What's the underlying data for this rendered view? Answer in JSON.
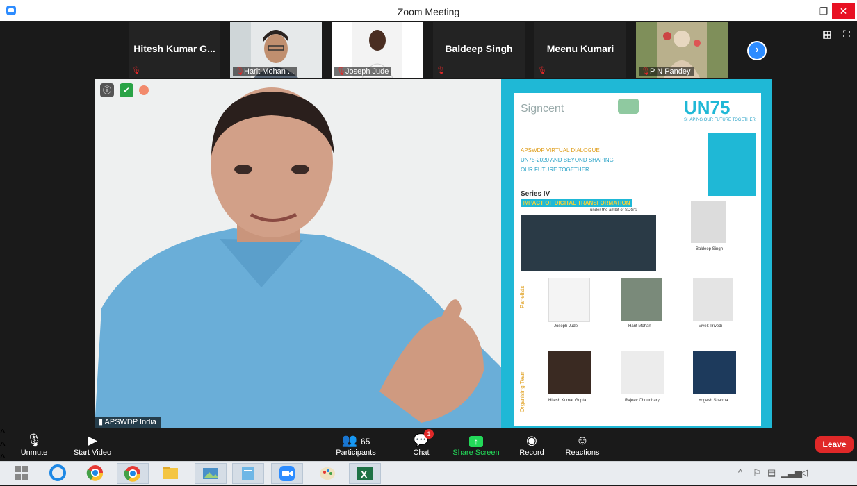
{
  "window": {
    "title": "Zoom Meeting",
    "min": "–",
    "max": "❐",
    "close": "✕"
  },
  "participants_strip": [
    {
      "name": "Hitesh Kumar G...",
      "has_video": false,
      "muted": true
    },
    {
      "name": "Harit Mohan ...",
      "has_video": true,
      "muted": true
    },
    {
      "name": "Joseph Jude",
      "has_video": true,
      "muted": true
    },
    {
      "name": "Baldeep Singh",
      "has_video": false,
      "muted": true
    },
    {
      "name": "Meenu Kumari",
      "has_video": false,
      "muted": true
    },
    {
      "name": "P N Pandey",
      "has_video": true,
      "muted": true
    }
  ],
  "strip_nav": {
    "next_icon": "›"
  },
  "view_controls": {
    "gallery_icon": "▦",
    "fullscreen_icon": "⛶"
  },
  "main_video": {
    "speaker_label": "APSWDP India",
    "icons": [
      "info-icon",
      "shield-icon",
      "record-dot-icon"
    ],
    "poster": {
      "org": "Signcent",
      "un75": "UN75",
      "un75_sub": "SHAPING OUR FUTURE TOGETHER",
      "headline_1": "APSWDP VIRTUAL DIALOGUE",
      "headline_2": "UN75-2020 AND BEYOND SHAPING",
      "headline_3": "OUR FUTURE TOGETHER",
      "series": "Series IV",
      "impact": "IMPACT OF DIGITAL TRANSFORMATION",
      "under": "under the ambit of SDG's",
      "chair_name": "Baldeep Singh",
      "panelists_label": "Panelists",
      "panelists": [
        "Joseph Jude",
        "Harit Mohan",
        "Vivek Trivedi"
      ],
      "org_team_label": "Organising Team",
      "team": [
        "Hitesh Kumar Gupta",
        "Rajeev Choudhary",
        "Yogesh Sharma"
      ]
    }
  },
  "toolbar": {
    "unmute": "Unmute",
    "start_video": "Start Video",
    "participants": "Participants",
    "participant_count": "65",
    "chat": "Chat",
    "chat_badge": "1",
    "share_screen": "Share Screen",
    "record": "Record",
    "reactions": "Reactions",
    "leave": "Leave"
  },
  "colors": {
    "accent": "#2d8cff",
    "leave": "#e02828",
    "share": "#23d959",
    "poster": "#1fb8d6"
  }
}
